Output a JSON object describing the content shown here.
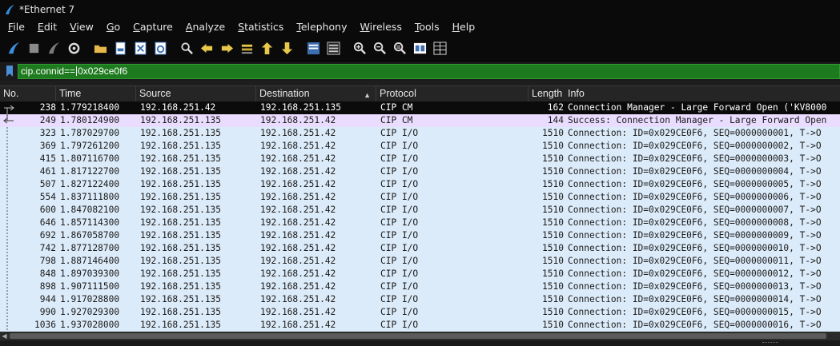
{
  "window": {
    "title": "*Ethernet 7"
  },
  "menu": [
    "File",
    "Edit",
    "View",
    "Go",
    "Capture",
    "Analyze",
    "Statistics",
    "Telephony",
    "Wireless",
    "Tools",
    "Help"
  ],
  "toolbar": {
    "icons": [
      "shark-fin-start-icon",
      "stop-icon",
      "restart-fin-icon",
      "options-gear-icon",
      "open-folder-icon",
      "save-file-icon",
      "close-file-icon",
      "reload-file-icon",
      "find-icon",
      "back-arrow-icon",
      "forward-arrow-icon",
      "go-to-packet-icon",
      "first-packet-icon",
      "last-packet-icon",
      "auto-scroll-icon",
      "colorize-icon",
      "zoom-in-icon",
      "zoom-out-icon",
      "normal-size-icon",
      "resize-columns-icon",
      "layout-icon"
    ]
  },
  "filter": {
    "value_before_caret": "cip.connid==",
    "value_after_caret": "0x029ce0f6"
  },
  "columns": {
    "no": "No.",
    "time": "Time",
    "source": "Source",
    "destination": "Destination",
    "protocol": "Protocol",
    "length": "Length",
    "info": "Info"
  },
  "packets": [
    {
      "no": "238",
      "time": "1.779218400",
      "src": "192.168.251.42",
      "dst": "192.168.251.135",
      "proto": "CIP CM",
      "len": "162",
      "info": "Connection Manager - Large Forward Open ('KV8000"
    },
    {
      "no": "249",
      "time": "1.780124900",
      "src": "192.168.251.135",
      "dst": "192.168.251.42",
      "proto": "CIP CM",
      "len": "144",
      "info": "Success: Connection Manager - Large Forward Open"
    },
    {
      "no": "323",
      "time": "1.787029700",
      "src": "192.168.251.135",
      "dst": "192.168.251.42",
      "proto": "CIP I/O",
      "len": "1510",
      "info": "Connection: ID=0x029CE0F6, SEQ=0000000001, T->O"
    },
    {
      "no": "369",
      "time": "1.797261200",
      "src": "192.168.251.135",
      "dst": "192.168.251.42",
      "proto": "CIP I/O",
      "len": "1510",
      "info": "Connection: ID=0x029CE0F6, SEQ=0000000002, T->O"
    },
    {
      "no": "415",
      "time": "1.807116700",
      "src": "192.168.251.135",
      "dst": "192.168.251.42",
      "proto": "CIP I/O",
      "len": "1510",
      "info": "Connection: ID=0x029CE0F6, SEQ=0000000003, T->O"
    },
    {
      "no": "461",
      "time": "1.817122700",
      "src": "192.168.251.135",
      "dst": "192.168.251.42",
      "proto": "CIP I/O",
      "len": "1510",
      "info": "Connection: ID=0x029CE0F6, SEQ=0000000004, T->O"
    },
    {
      "no": "507",
      "time": "1.827122400",
      "src": "192.168.251.135",
      "dst": "192.168.251.42",
      "proto": "CIP I/O",
      "len": "1510",
      "info": "Connection: ID=0x029CE0F6, SEQ=0000000005, T->O"
    },
    {
      "no": "554",
      "time": "1.837111800",
      "src": "192.168.251.135",
      "dst": "192.168.251.42",
      "proto": "CIP I/O",
      "len": "1510",
      "info": "Connection: ID=0x029CE0F6, SEQ=0000000006, T->O"
    },
    {
      "no": "600",
      "time": "1.847082100",
      "src": "192.168.251.135",
      "dst": "192.168.251.42",
      "proto": "CIP I/O",
      "len": "1510",
      "info": "Connection: ID=0x029CE0F6, SEQ=0000000007, T->O"
    },
    {
      "no": "646",
      "time": "1.857114300",
      "src": "192.168.251.135",
      "dst": "192.168.251.42",
      "proto": "CIP I/O",
      "len": "1510",
      "info": "Connection: ID=0x029CE0F6, SEQ=0000000008, T->O"
    },
    {
      "no": "692",
      "time": "1.867058700",
      "src": "192.168.251.135",
      "dst": "192.168.251.42",
      "proto": "CIP I/O",
      "len": "1510",
      "info": "Connection: ID=0x029CE0F6, SEQ=0000000009, T->O"
    },
    {
      "no": "742",
      "time": "1.877128700",
      "src": "192.168.251.135",
      "dst": "192.168.251.42",
      "proto": "CIP I/O",
      "len": "1510",
      "info": "Connection: ID=0x029CE0F6, SEQ=0000000010, T->O"
    },
    {
      "no": "798",
      "time": "1.887146400",
      "src": "192.168.251.135",
      "dst": "192.168.251.42",
      "proto": "CIP I/O",
      "len": "1510",
      "info": "Connection: ID=0x029CE0F6, SEQ=0000000011, T->O"
    },
    {
      "no": "848",
      "time": "1.897039300",
      "src": "192.168.251.135",
      "dst": "192.168.251.42",
      "proto": "CIP I/O",
      "len": "1510",
      "info": "Connection: ID=0x029CE0F6, SEQ=0000000012, T->O"
    },
    {
      "no": "898",
      "time": "1.907111500",
      "src": "192.168.251.135",
      "dst": "192.168.251.42",
      "proto": "CIP I/O",
      "len": "1510",
      "info": "Connection: ID=0x029CE0F6, SEQ=0000000013, T->O"
    },
    {
      "no": "944",
      "time": "1.917028800",
      "src": "192.168.251.135",
      "dst": "192.168.251.42",
      "proto": "CIP I/O",
      "len": "1510",
      "info": "Connection: ID=0x029CE0F6, SEQ=0000000014, T->O"
    },
    {
      "no": "990",
      "time": "1.927029300",
      "src": "192.168.251.135",
      "dst": "192.168.251.42",
      "proto": "CIP I/O",
      "len": "1510",
      "info": "Connection: ID=0x029CE0F6, SEQ=0000000015, T->O"
    },
    {
      "no": "1036",
      "time": "1.937028000",
      "src": "192.168.251.135",
      "dst": "192.168.251.42",
      "proto": "CIP I/O",
      "len": "1510",
      "info": "Connection: ID=0x029CE0F6, SEQ=0000000016, T->O"
    }
  ],
  "colors": {
    "filter_valid": "#1e7a1e",
    "row_io": "#dcebf9",
    "row_cm": "#e9dcff",
    "row_selected": "#0b0b0b"
  }
}
